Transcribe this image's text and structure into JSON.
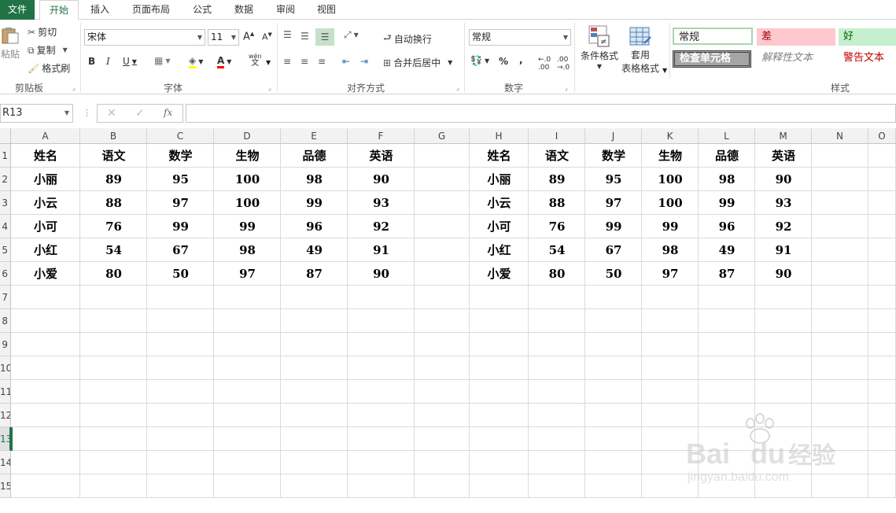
{
  "tabs": [
    {
      "label": "文件"
    },
    {
      "label": "开始"
    },
    {
      "label": "插入"
    },
    {
      "label": "页面布局"
    },
    {
      "label": "公式"
    },
    {
      "label": "数据"
    },
    {
      "label": "审阅"
    },
    {
      "label": "视图"
    }
  ],
  "ribbon": {
    "clipboard": {
      "paste": "粘贴",
      "cut": "剪切",
      "copy": "复制",
      "format_painter": "格式刷",
      "group": "剪贴板"
    },
    "font": {
      "name": "宋体",
      "size": "11",
      "bold": "B",
      "italic": "I",
      "underline": "U",
      "group": "字体",
      "phonetic_top": "wén",
      "phonetic_bottom": "文"
    },
    "alignment": {
      "wrap": "自动换行",
      "merge": "合并后居中",
      "group": "对齐方式"
    },
    "number": {
      "format": "常规",
      "percent": "%",
      "comma": ",",
      "group": "数字"
    },
    "styles": {
      "conditional": "条件格式",
      "table_fmt_line1": "套用",
      "table_fmt_line2": "表格格式",
      "normal": "常规",
      "bad": "差",
      "good": "好",
      "check_cell": "检查单元格",
      "explanatory": "解释性文本",
      "warning": "警告文本",
      "group": "样式"
    }
  },
  "formula_bar": {
    "name_box": "R13",
    "fx": "fx"
  },
  "columns": [
    "A",
    "B",
    "C",
    "D",
    "E",
    "F",
    "G",
    "H",
    "I",
    "J",
    "K",
    "L",
    "M",
    "N",
    "O"
  ],
  "rows": [
    "1",
    "2",
    "3",
    "4",
    "5",
    "6",
    "7",
    "8",
    "9",
    "10",
    "11",
    "12",
    "13",
    "14",
    "15"
  ],
  "table_left": {
    "headers": [
      "姓名",
      "语文",
      "数学",
      "生物",
      "品德",
      "英语"
    ],
    "rows": [
      [
        "小丽",
        "89",
        "95",
        "100",
        "98",
        "90"
      ],
      [
        "小云",
        "88",
        "97",
        "100",
        "99",
        "93"
      ],
      [
        "小可",
        "76",
        "99",
        "99",
        "96",
        "92"
      ],
      [
        "小红",
        "54",
        "67",
        "98",
        "49",
        "91"
      ],
      [
        "小爱",
        "80",
        "50",
        "97",
        "87",
        "90"
      ]
    ]
  },
  "table_right": {
    "headers": [
      "姓名",
      "语文",
      "数学",
      "生物",
      "品德",
      "英语"
    ],
    "rows": [
      [
        "小丽",
        "89",
        "95",
        "100",
        "98",
        "90"
      ],
      [
        "小云",
        "88",
        "97",
        "100",
        "99",
        "93"
      ],
      [
        "小可",
        "76",
        "99",
        "99",
        "96",
        "92"
      ],
      [
        "小红",
        "54",
        "67",
        "98",
        "49",
        "91"
      ],
      [
        "小爱",
        "80",
        "50",
        "97",
        "87",
        "90"
      ]
    ]
  },
  "watermark": {
    "brand_left": "Bai",
    "brand_right": "du",
    "brand_cn": "经验",
    "url": "jingyan.baidu.com"
  },
  "colors": {
    "accent": "#217346",
    "bad_bg": "#ffc7ce",
    "good_bg": "#c6efce",
    "warning_text": "#c00000"
  }
}
